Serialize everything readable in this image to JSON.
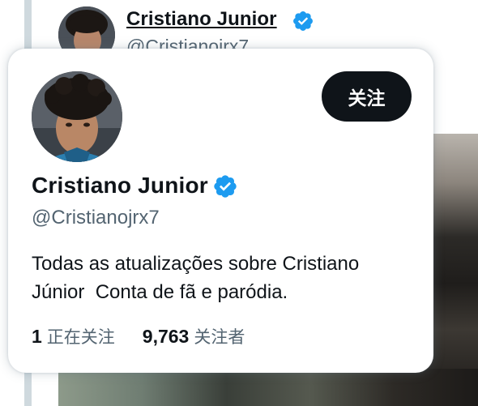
{
  "background_tweet": {
    "name": "Cristiano Junior",
    "handle": "@Cristianojrx7",
    "verified_badge_icon": "verified-badge-icon"
  },
  "hover_card": {
    "follow_label": "关注",
    "name": "Cristiano Junior",
    "handle": "@Cristianojrx7",
    "verified_badge_icon": "verified-badge-icon",
    "bio": "Todas as atualizações sobre Cristiano\nJúnior  Conta de fã e paródia.",
    "stats": {
      "following_count": "1",
      "following_label": "正在关注",
      "followers_count": "9,763",
      "followers_label": "关注者"
    }
  },
  "colors": {
    "primary_text": "#0f1419",
    "secondary_text": "#536471",
    "verified_blue": "#1d9bf0",
    "follow_button_bg": "#0f1419",
    "follow_button_text": "#ffffff"
  }
}
